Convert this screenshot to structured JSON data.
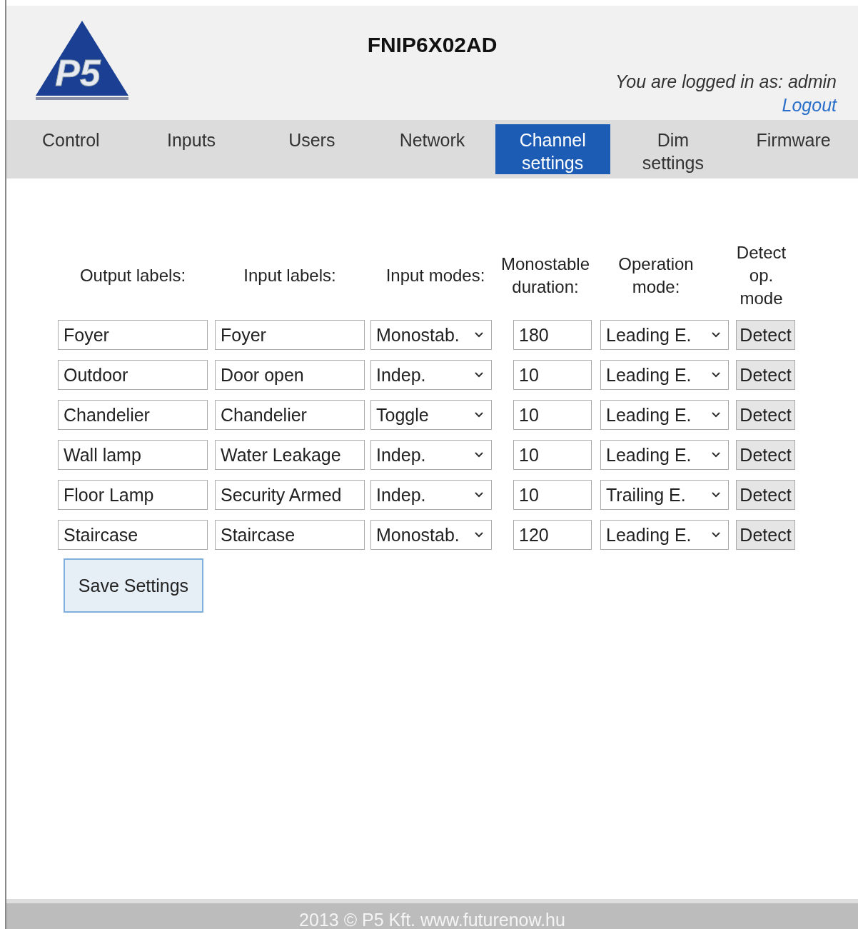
{
  "header": {
    "logo_text": "P5",
    "title": "FNIP6X02AD",
    "login_text": "You are logged in as: admin",
    "logout": "Logout"
  },
  "tabs": [
    {
      "label": "Control",
      "selected": false
    },
    {
      "label": "Inputs",
      "selected": false
    },
    {
      "label": "Users",
      "selected": false
    },
    {
      "label": "Network",
      "selected": false
    },
    {
      "label": "Channel settings",
      "selected": true
    },
    {
      "label": "Dim settings",
      "selected": false
    },
    {
      "label": "Firmware",
      "selected": false
    }
  ],
  "table": {
    "columns": [
      "Output labels:",
      "Input labels:",
      "Input modes:",
      "Monostable duration:",
      "Operation mode:",
      "Detect op. mode"
    ],
    "rows": [
      {
        "output_label": "Foyer",
        "input_label": "Foyer",
        "input_mode": "Monostab.",
        "duration": "180",
        "operation_mode": "Leading E.",
        "detect": "Detect"
      },
      {
        "output_label": "Outdoor",
        "input_label": "Door open",
        "input_mode": "Indep.",
        "duration": "10",
        "operation_mode": "Leading E.",
        "detect": "Detect"
      },
      {
        "output_label": "Chandelier",
        "input_label": "Chandelier",
        "input_mode": "Toggle",
        "duration": "10",
        "operation_mode": "Leading E.",
        "detect": "Detect"
      },
      {
        "output_label": "Wall lamp",
        "input_label": "Water Leakage",
        "input_mode": "Indep.",
        "duration": "10",
        "operation_mode": "Leading E.",
        "detect": "Detect"
      },
      {
        "output_label": "Floor Lamp",
        "input_label": "Security Armed",
        "input_mode": "Indep.",
        "duration": "10",
        "operation_mode": "Trailing E.",
        "detect": "Detect"
      },
      {
        "output_label": "Staircase",
        "input_label": "Staircase",
        "input_mode": "Monostab.",
        "duration": "120",
        "operation_mode": "Leading E.",
        "detect": "Detect"
      }
    ]
  },
  "save_button": "Save Settings",
  "footer": "2013 © P5 Kft.  www.futurenow.hu"
}
